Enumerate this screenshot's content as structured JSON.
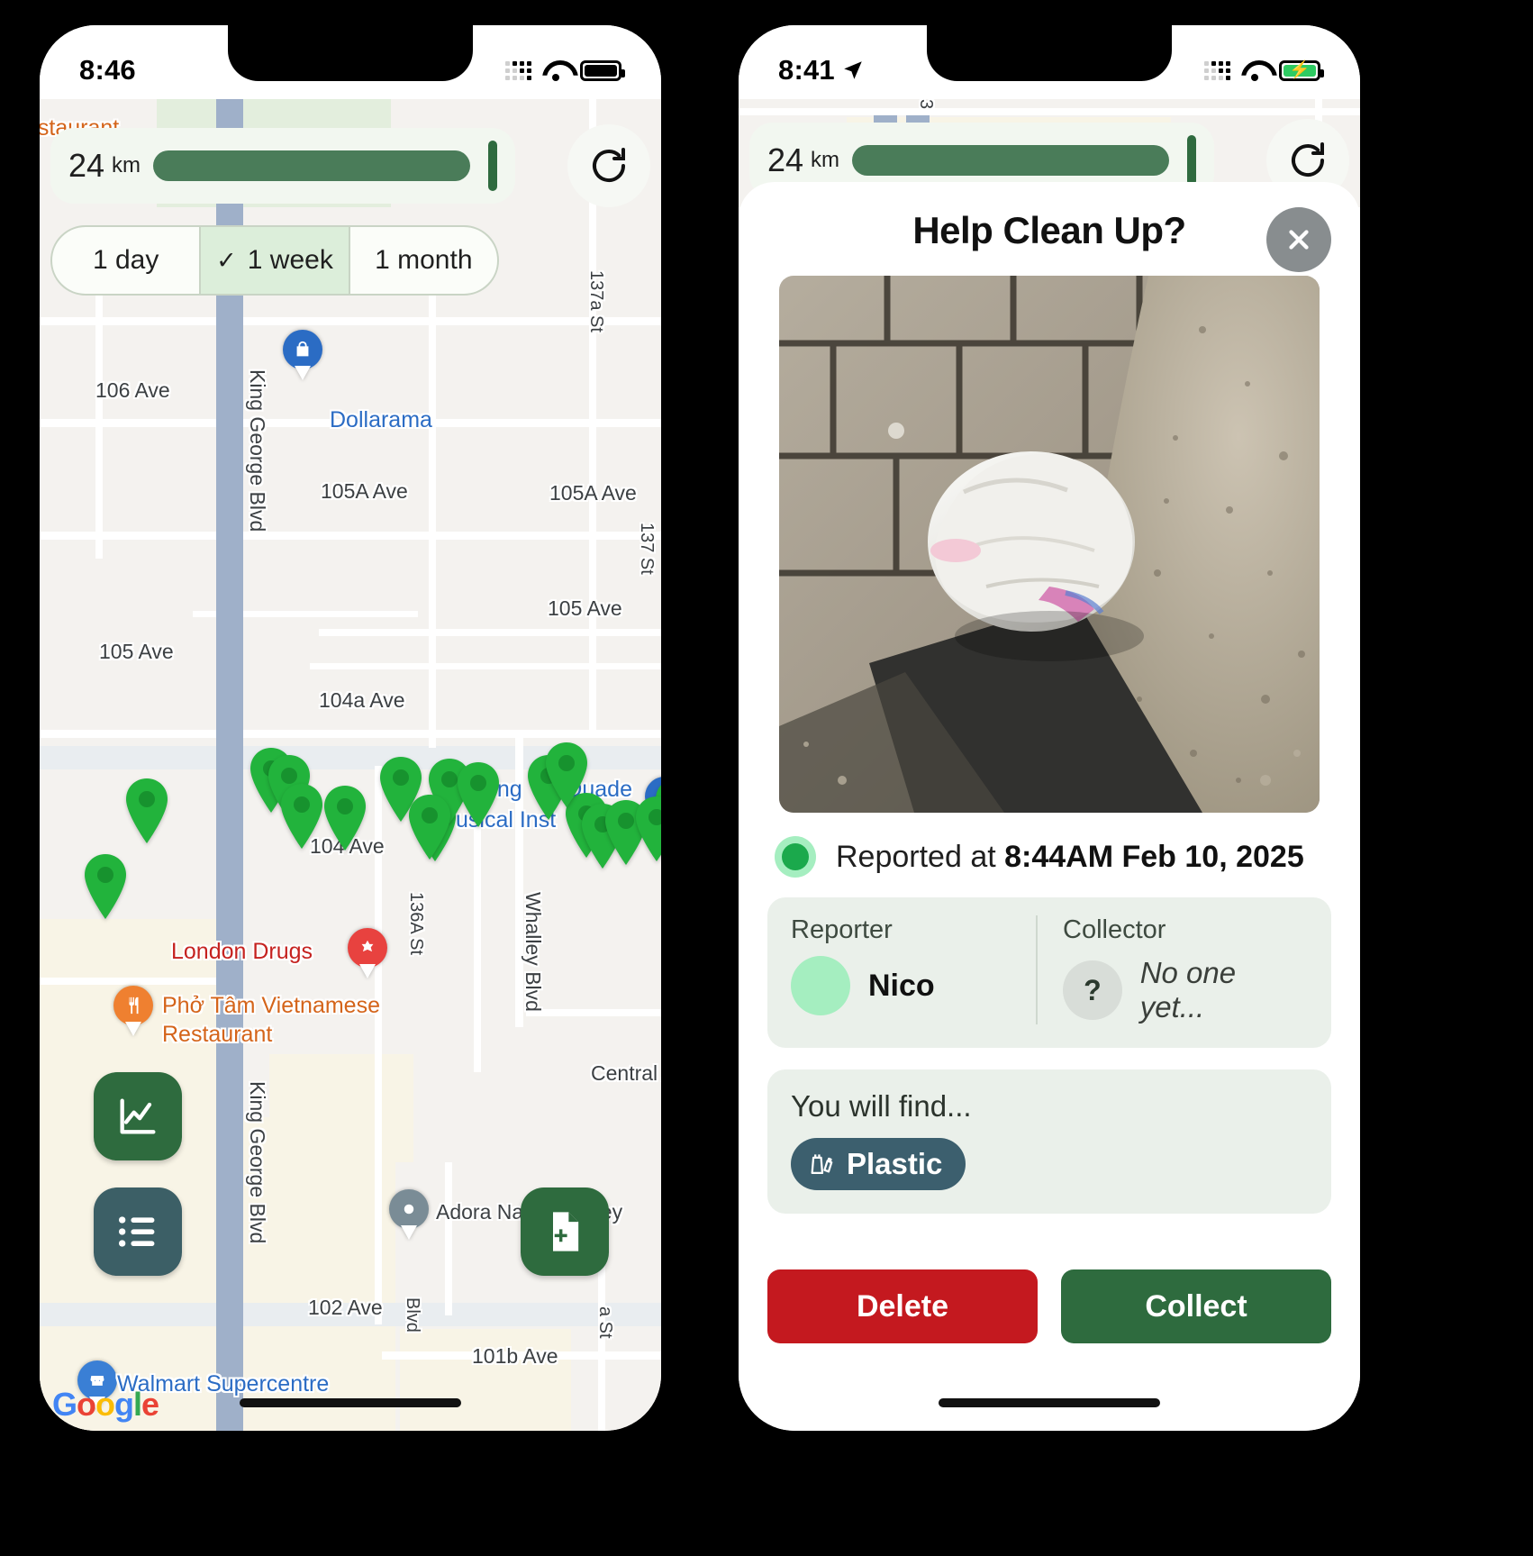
{
  "left_phone": {
    "status_bar": {
      "time": "8:46",
      "battery_state": "full",
      "wifi": "wifi-icon",
      "signal": "cellular-icon"
    },
    "distance_filter": {
      "value": "24",
      "unit": "km",
      "slider_percent": 92
    },
    "refresh_label": "refresh-icon",
    "time_range": {
      "options": [
        {
          "label": "1 day",
          "selected": false
        },
        {
          "label": "1 week",
          "selected": true,
          "check": "✓"
        },
        {
          "label": "1 month",
          "selected": false
        }
      ]
    },
    "map": {
      "street_labels": [
        "106 Ave",
        "105A Ave",
        "105A Ave",
        "105 Ave",
        "105 Ave",
        "104a Ave",
        "104 Ave",
        "102 Ave",
        "101b Ave",
        "Central Ave"
      ],
      "vertical_labels": [
        "King George Blvd",
        "137a St",
        "137 St",
        "136A St",
        "Whalley Blvd",
        "King George Blvd",
        "a St",
        "Blvd"
      ],
      "pois": [
        {
          "name": "Dollarama",
          "color": "#2b6cc4",
          "icon": "shopping-bag-icon"
        },
        {
          "name": "Long & McQuade Musical Instruments",
          "color": "#2b6cc4",
          "icon": "store-icon"
        },
        {
          "name": "London Drugs",
          "color": "#c5221f",
          "icon": "pharmacy-icon"
        },
        {
          "name": "Phở Tâm Vietnamese Restaurant",
          "color": "#d4641a",
          "icon": "restaurant-icon"
        },
        {
          "name": "Adora Nails Whalley",
          "color": "#3c4043",
          "icon": "place-icon"
        },
        {
          "name": "Walmart Supercentre",
          "color": "#2b6cc4",
          "icon": "store-icon"
        }
      ],
      "report_pin_count": 18,
      "pin_color": "#22b33c",
      "watermark": "Google"
    },
    "fab_buttons": [
      {
        "name": "stats-button",
        "icon": "chart-line-icon",
        "color": "#2e6b3e"
      },
      {
        "name": "list-button",
        "icon": "list-icon",
        "color": "#3c5f66"
      },
      {
        "name": "add-report-button",
        "icon": "file-plus-icon",
        "color": "#2e6b3e"
      }
    ]
  },
  "right_phone": {
    "status_bar": {
      "time": "8:41",
      "location_arrow": "location-arrow-icon",
      "battery_state": "charging",
      "wifi": "wifi-icon",
      "signal": "cellular-icon"
    },
    "distance_filter": {
      "value": "24",
      "unit": "km",
      "slider_percent": 92
    },
    "modal": {
      "title": "Help Clean Up?",
      "close_label": "close-icon",
      "photo_alt": "plastic-bag-on-pavement-photo",
      "reported": {
        "prefix": "Reported at ",
        "timestamp": "8:44AM Feb 10, 2025",
        "status_color": "#1ba94c"
      },
      "people": {
        "reporter_label": "Reporter",
        "reporter_name": "Nico",
        "collector_label": "Collector",
        "collector_placeholder": "?",
        "collector_name": "No one yet..."
      },
      "find": {
        "label": "You will find...",
        "tags": [
          {
            "label": "Plastic",
            "icon": "plastic-bag-icon",
            "color": "#3c5f6e"
          }
        ]
      },
      "actions": [
        {
          "label": "Delete",
          "color": "#c4191f"
        },
        {
          "label": "Collect",
          "color": "#2e6b3e"
        }
      ]
    }
  }
}
